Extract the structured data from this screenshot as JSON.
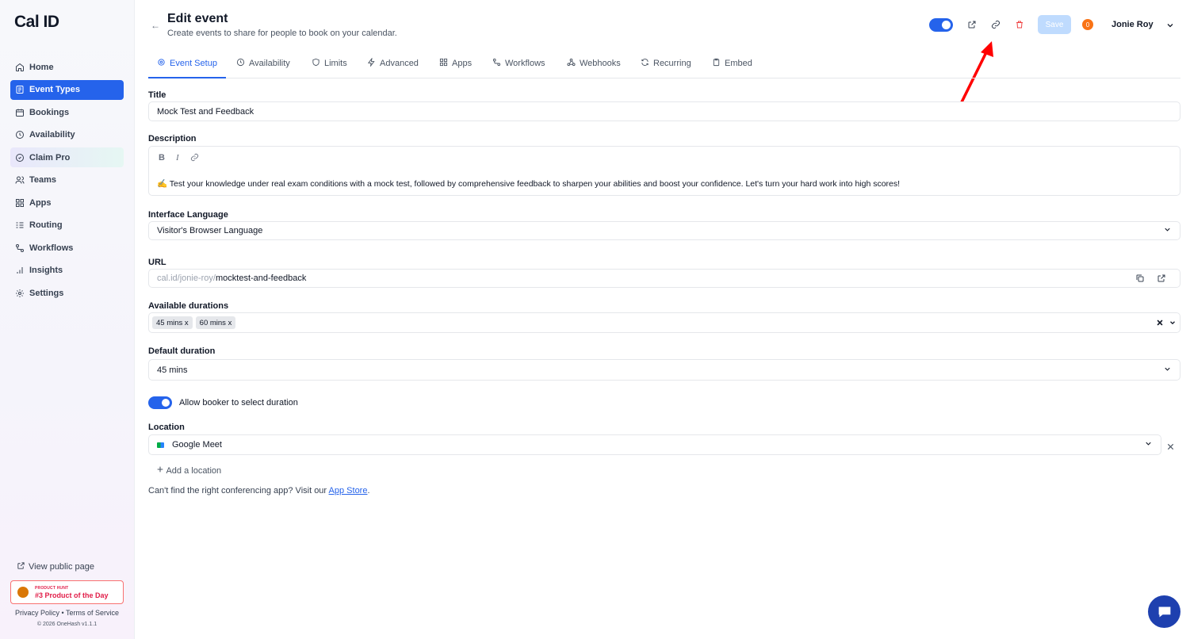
{
  "brand": {
    "logo": "Cal ID",
    "accent": "#2563eb"
  },
  "sidebar": {
    "items": [
      {
        "label": "Home",
        "icon": "home-icon"
      },
      {
        "label": "Event Types",
        "icon": "link-list-icon",
        "active": true
      },
      {
        "label": "Bookings",
        "icon": "calendar-icon"
      },
      {
        "label": "Availability",
        "icon": "clock-icon"
      },
      {
        "label": "Claim Pro",
        "icon": "badge-icon"
      },
      {
        "label": "Teams",
        "icon": "users-icon"
      },
      {
        "label": "Apps",
        "icon": "grid-icon"
      },
      {
        "label": "Routing",
        "icon": "route-icon"
      },
      {
        "label": "Workflows",
        "icon": "workflow-icon"
      },
      {
        "label": "Insights",
        "icon": "bar-chart-icon"
      },
      {
        "label": "Settings",
        "icon": "gear-icon"
      }
    ],
    "view_public": "View public page",
    "product_hunt": {
      "small": "PRODUCT HUNT",
      "big": "#3 Product of the Day"
    },
    "privacy": "Privacy Policy",
    "dot": "•",
    "terms": "Terms of Service",
    "copyright": "© 2026 OneHash v1.1.1"
  },
  "header": {
    "back": "←",
    "title": "Edit event",
    "subtitle": "Create events to share for people to book on your calendar.",
    "save": "Save",
    "notifications": "0",
    "user": "Jonie Roy"
  },
  "tabs": [
    {
      "label": "Event Setup",
      "active": true
    },
    {
      "label": "Availability"
    },
    {
      "label": "Limits"
    },
    {
      "label": "Advanced"
    },
    {
      "label": "Apps"
    },
    {
      "label": "Workflows"
    },
    {
      "label": "Webhooks"
    },
    {
      "label": "Recurring"
    },
    {
      "label": "Embed"
    }
  ],
  "form": {
    "title_label": "Title",
    "title_value": "Mock Test and Feedback",
    "description_label": "Description",
    "description_tools": {
      "bold": "B",
      "italic": "I"
    },
    "description_value": "✍️ Test your knowledge under real exam conditions with a mock test, followed by comprehensive feedback to sharpen your abilities and boost your confidence. Let's turn your hard work into high scores!",
    "language_label": "Interface Language",
    "language_value": "Visitor's Browser Language",
    "url_label": "URL",
    "url_prefix": "cal.id/jonie-roy/",
    "url_slug": "mocktest-and-feedback",
    "durations_label": "Available durations",
    "durations": [
      "45 mins",
      "60 mins"
    ],
    "pill_remove": "x",
    "default_duration_label": "Default duration",
    "default_duration_value": "45 mins",
    "allow_booker_label": "Allow booker to select duration",
    "location_label": "Location",
    "location_value": "Google Meet",
    "add_location": "Add a location",
    "hint_text": "Can't find the right conferencing app? Visit our ",
    "hint_link": "App Store",
    "hint_end": "."
  }
}
